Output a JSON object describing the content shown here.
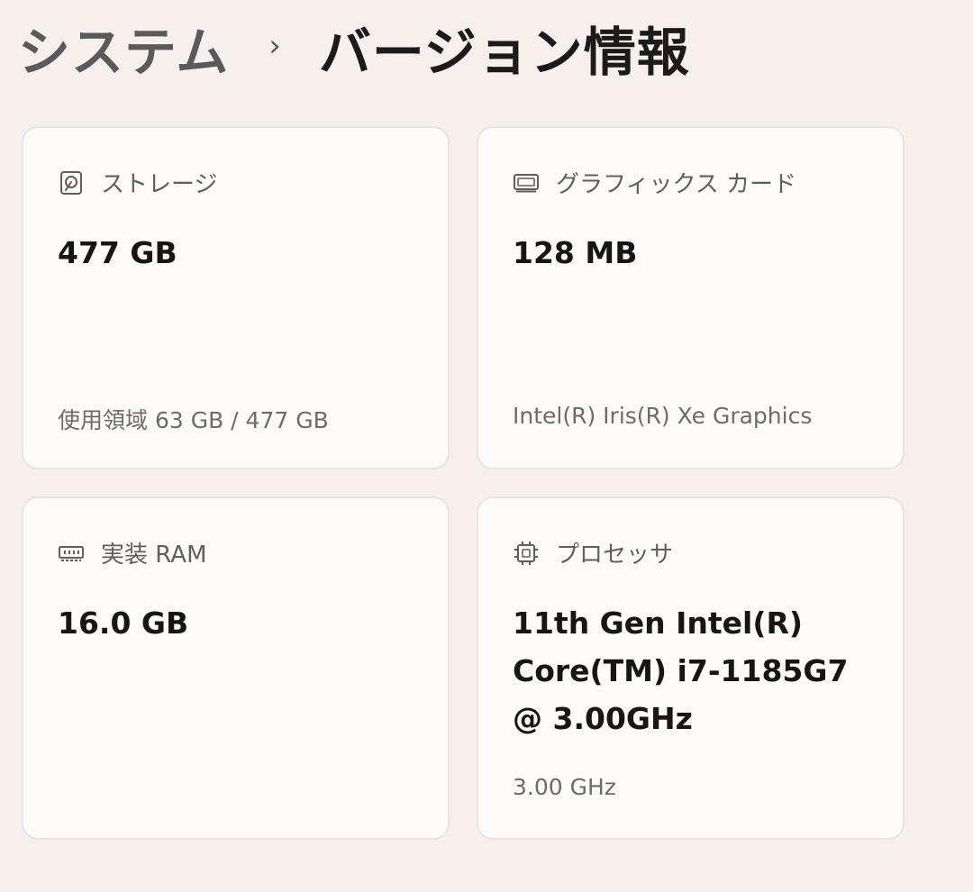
{
  "breadcrumb": {
    "parent": "システム",
    "separator": "›",
    "current": "バージョン情報"
  },
  "cards": {
    "storage": {
      "icon": "hard-drive-icon",
      "label": "ストレージ",
      "value": "477 GB",
      "detail": "使用領域 63 GB / 477 GB"
    },
    "graphics": {
      "icon": "graphics-card-icon",
      "label": "グラフィックス カード",
      "value": "128 MB",
      "detail": "Intel(R) Iris(R) Xe Graphics"
    },
    "ram": {
      "icon": "memory-icon",
      "label": "実装 RAM",
      "value": "16.0 GB"
    },
    "processor": {
      "icon": "processor-chip-icon",
      "label": "プロセッサ",
      "value": "11th Gen Intel(R) Core(TM) i7-1185G7 @ 3.00GHz",
      "detail": "3.00 GHz"
    }
  },
  "colors": {
    "background": "#f6f0ec",
    "card_background": "#fcfbf9",
    "card_border": "#ebe4df"
  }
}
